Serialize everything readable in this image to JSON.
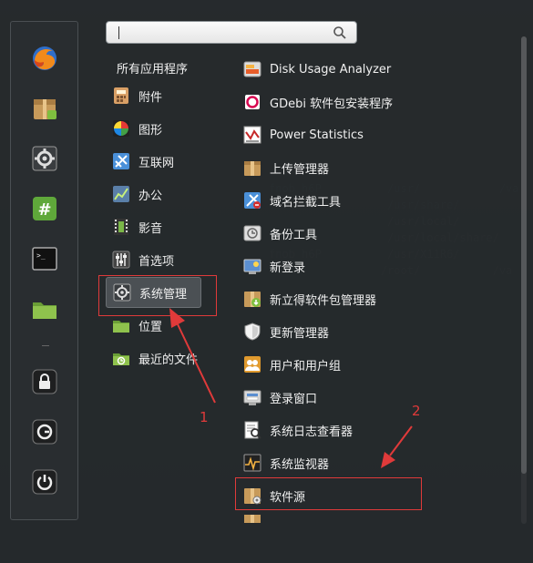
{
  "search": {
    "placeholder": "",
    "value": ""
  },
  "favorites": [
    {
      "name": "firefox-icon"
    },
    {
      "name": "package-installer-icon"
    },
    {
      "name": "system-settings-icon"
    },
    {
      "name": "terminal-hash-icon"
    },
    {
      "name": "terminal-icon"
    },
    {
      "name": "folder-icon"
    },
    {
      "name": "lock-screen-icon"
    },
    {
      "name": "logout-icon"
    },
    {
      "name": "shutdown-icon"
    }
  ],
  "categories": {
    "header": "所有应用程序",
    "items": [
      {
        "label": "附件",
        "icon": "accessories-icon"
      },
      {
        "label": "图形",
        "icon": "graphics-icon"
      },
      {
        "label": "互联网",
        "icon": "internet-icon"
      },
      {
        "label": "办公",
        "icon": "office-icon"
      },
      {
        "label": "影音",
        "icon": "multimedia-icon"
      },
      {
        "label": "首选项",
        "icon": "preferences-icon"
      },
      {
        "label": "系统管理",
        "icon": "administration-icon",
        "active": true
      },
      {
        "label": "位置",
        "icon": "places-icon"
      },
      {
        "label": "最近的文件",
        "icon": "recent-files-icon"
      }
    ]
  },
  "apps": [
    {
      "label": "Disk Usage Analyzer",
      "icon": "disk-usage-icon"
    },
    {
      "label": "GDebi 软件包安装程序",
      "icon": "gdebi-icon"
    },
    {
      "label": "Power Statistics",
      "icon": "power-stats-icon"
    },
    {
      "label": "上传管理器",
      "icon": "upload-manager-icon"
    },
    {
      "label": "域名拦截工具",
      "icon": "domain-blocker-icon"
    },
    {
      "label": "备份工具",
      "icon": "backup-icon"
    },
    {
      "label": "新登录",
      "icon": "new-login-icon"
    },
    {
      "label": "新立得软件包管理器",
      "icon": "synaptic-icon"
    },
    {
      "label": "更新管理器",
      "icon": "update-manager-icon"
    },
    {
      "label": "用户和用户组",
      "icon": "users-groups-icon"
    },
    {
      "label": "登录窗口",
      "icon": "login-window-icon"
    },
    {
      "label": "系统日志查看器",
      "icon": "log-viewer-icon"
    },
    {
      "label": "系统监视器",
      "icon": "system-monitor-icon"
    },
    {
      "label": "软件源",
      "icon": "software-sources-icon"
    }
  ],
  "annotations": {
    "label_1": "1",
    "label_2": "2"
  },
  "colors": {
    "annotation_red": "#e03a3a",
    "active_bg": "#4b5054"
  }
}
